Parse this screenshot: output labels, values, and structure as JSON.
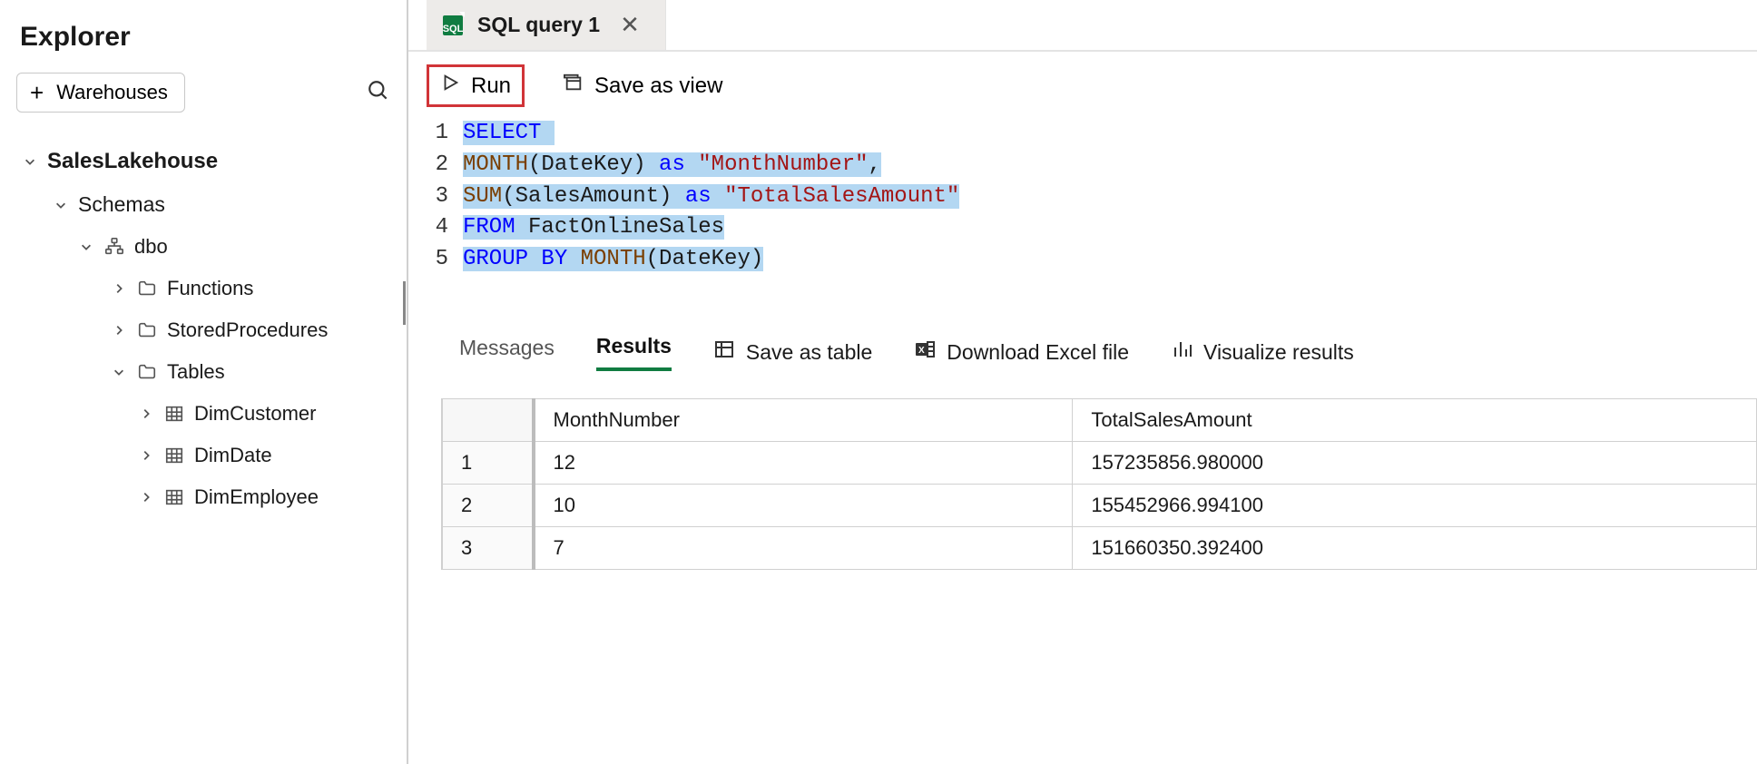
{
  "explorer": {
    "title": "Explorer",
    "warehouses_label": "Warehouses",
    "tree": {
      "root": "SalesLakehouse",
      "schemas_label": "Schemas",
      "schema_name": "dbo",
      "folders": {
        "functions": "Functions",
        "storedprocs": "StoredProcedures",
        "tables": "Tables"
      },
      "tables": [
        "DimCustomer",
        "DimDate",
        "DimEmployee"
      ]
    }
  },
  "tab": {
    "label": "SQL query 1",
    "badge": "SQL"
  },
  "toolbar": {
    "run_label": "Run",
    "save_view_label": "Save as view"
  },
  "editor": {
    "lines": [
      {
        "n": "1",
        "tokens": [
          {
            "t": "SELECT",
            "c": "kw"
          },
          {
            "t": " ",
            "c": "pad"
          }
        ]
      },
      {
        "n": "2",
        "tokens": [
          {
            "t": "MONTH",
            "c": "fn"
          },
          {
            "t": "(DateKey) ",
            "c": "txt"
          },
          {
            "t": "as ",
            "c": "kw"
          },
          {
            "t": "\"MonthNumber\"",
            "c": "str"
          },
          {
            "t": ",",
            "c": "txt"
          }
        ]
      },
      {
        "n": "3",
        "tokens": [
          {
            "t": "SUM",
            "c": "fn"
          },
          {
            "t": "(SalesAmount) ",
            "c": "txt"
          },
          {
            "t": "as ",
            "c": "kw"
          },
          {
            "t": "\"TotalSalesAmount\"",
            "c": "str"
          }
        ]
      },
      {
        "n": "4",
        "tokens": [
          {
            "t": "FROM ",
            "c": "kw"
          },
          {
            "t": "FactOnlineSales",
            "c": "txt"
          }
        ]
      },
      {
        "n": "5",
        "tokens": [
          {
            "t": "GROUP BY ",
            "c": "kw"
          },
          {
            "t": "MONTH",
            "c": "fn"
          },
          {
            "t": "(DateKey)",
            "c": "txt"
          }
        ]
      }
    ]
  },
  "results_bar": {
    "messages_label": "Messages",
    "results_label": "Results",
    "save_table_label": "Save as table",
    "download_label": "Download Excel file",
    "visualize_label": "Visualize results"
  },
  "results": {
    "columns": [
      "MonthNumber",
      "TotalSalesAmount"
    ],
    "rows": [
      {
        "n": "1",
        "cells": [
          "12",
          "157235856.980000"
        ]
      },
      {
        "n": "2",
        "cells": [
          "10",
          "155452966.994100"
        ]
      },
      {
        "n": "3",
        "cells": [
          "7",
          "151660350.392400"
        ]
      }
    ]
  }
}
